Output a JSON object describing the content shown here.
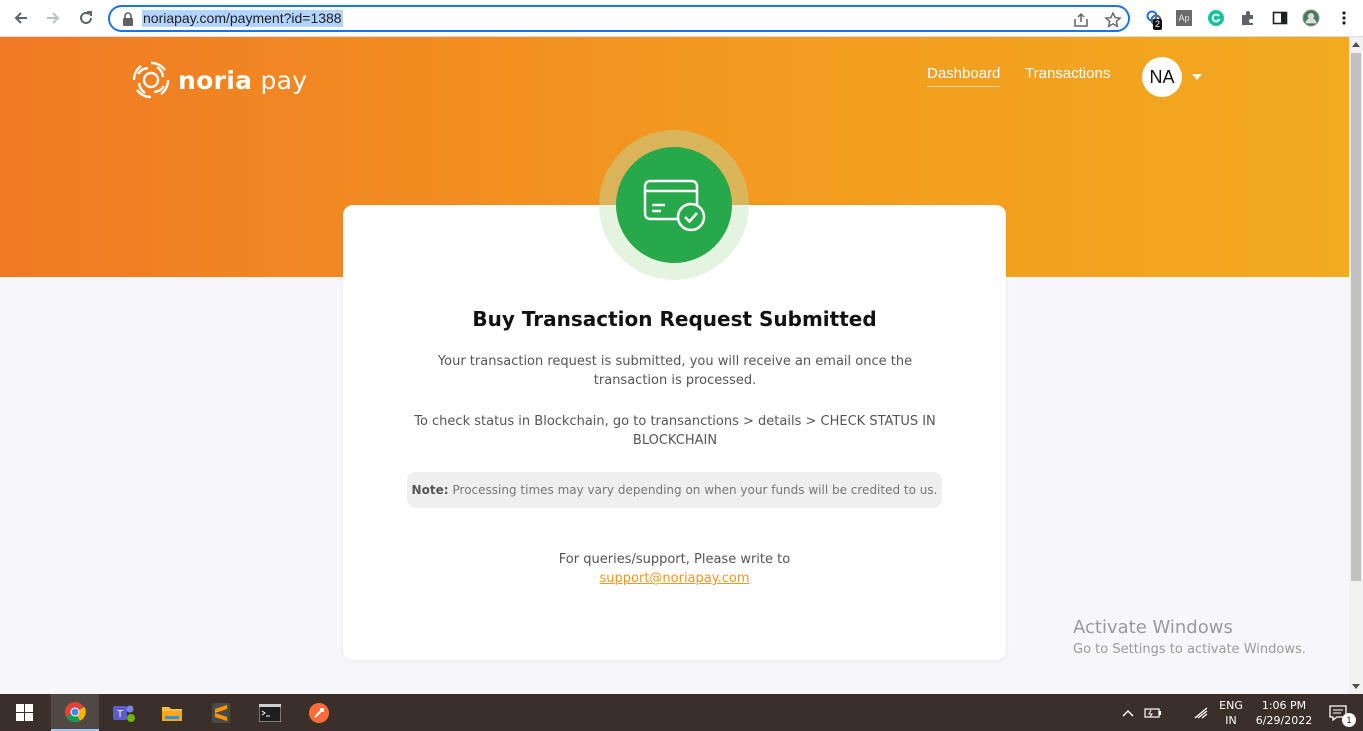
{
  "browser": {
    "url": "noriapay.com/payment?id=1388",
    "extension_badge": "2",
    "extension_ap_label": "Ap"
  },
  "header": {
    "logo_bold": "noria",
    "logo_light": " pay",
    "nav": [
      {
        "label": "Dashboard"
      },
      {
        "label": "Transactions"
      }
    ],
    "avatar_initials": "NA"
  },
  "card": {
    "title": "Buy Transaction Request Submitted",
    "message": "Your transaction request is submitted, you will receive an email once the transaction is processed.",
    "status_instructions": "To check status in Blockchain, go to transanctions > details > CHECK STATUS IN BLOCKCHAIN",
    "note_label": "Note:",
    "note_text": "Processing times may vary depending on when your funds will be credited to us.",
    "support_text": "For queries/support, Please write to",
    "support_email": "support@noriapay.com"
  },
  "watermark": {
    "line1": "Activate Windows",
    "line2": "Go to Settings to activate Windows."
  },
  "taskbar": {
    "language": "ENG",
    "region": "IN",
    "time": "1:06 PM",
    "date": "6/29/2022",
    "notification_count": "1"
  },
  "colors": {
    "brand_orange": "#f07a24",
    "brand_amber": "#f2aa1f",
    "success_green": "#27a84a",
    "link_orange": "#f0962a"
  }
}
